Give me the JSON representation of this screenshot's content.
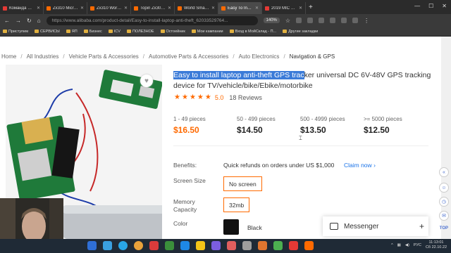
{
  "tabs": [
    {
      "title": "Команда Навального",
      "active": false
    },
    {
      "title": "Zx310 Micro Gsm",
      "active": false
    },
    {
      "title": "Zx310 World Smallest",
      "active": false
    },
    {
      "title": "Topin Zx302 Micro",
      "active": false
    },
    {
      "title": "World Smallest Mini",
      "active": false
    },
    {
      "title": "Easy To Install Lap",
      "active": true
    },
    {
      "title": "2019 MIC Аудио",
      "active": false
    }
  ],
  "address": {
    "url": "https://www.alibaba.com/product-detail/Easy-to-install-laptop-anti-theft_62033529764...",
    "zoom": "140%"
  },
  "bookmarks": [
    "Приступим",
    "СЕРВИСЫ",
    "ЯП",
    "Бизнес",
    "ICV",
    "ПОЛЕЗНОЕ",
    "Остоейник",
    "Мои кампании",
    "Вход в МойСклад - П...",
    "Другие закладки"
  ],
  "breadcrumbs": [
    "Home",
    "All Industries",
    "Vehicle Parts & Accessories",
    "Automotive Parts & Accessories",
    "Auto Electronics",
    "Navigation & GPS"
  ],
  "product": {
    "title_selected": "Easy to install laptop anti-theft GPS trac",
    "title_rest": "ker universal DC 6V-48V GPS tracking device for TV/vehicle/bike/Ebike/motorbike",
    "rating": "5.0",
    "reviews": "18 Reviews"
  },
  "price_tiers": [
    {
      "qty": "1 - 49 pieces",
      "price": "$16.50"
    },
    {
      "qty": "50 - 499 pieces",
      "price": "$14.50"
    },
    {
      "qty": "500 - 4999 pieces",
      "price": "$13.50"
    },
    {
      "qty": ">= 5000 pieces",
      "price": "$12.50"
    }
  ],
  "options": {
    "benefits_label": "Benefits:",
    "benefits_text": "Quick refunds on orders under US $1,000",
    "claim_label": "Claim now",
    "screen_size_label": "Screen Size",
    "screen_size_value": "No screen",
    "memory_label": "Memory Capacity",
    "memory_value": "32mb",
    "color_label": "Color",
    "color_value": "Black"
  },
  "messenger": {
    "label": "Messenger"
  },
  "taskbar": {
    "lang": "РУС",
    "time": "11:13:01",
    "date": "Сб 22.10.22"
  },
  "colors": {
    "accent": "#ff6a00",
    "link": "#1a73e8",
    "selection": "#3b7bd8"
  }
}
